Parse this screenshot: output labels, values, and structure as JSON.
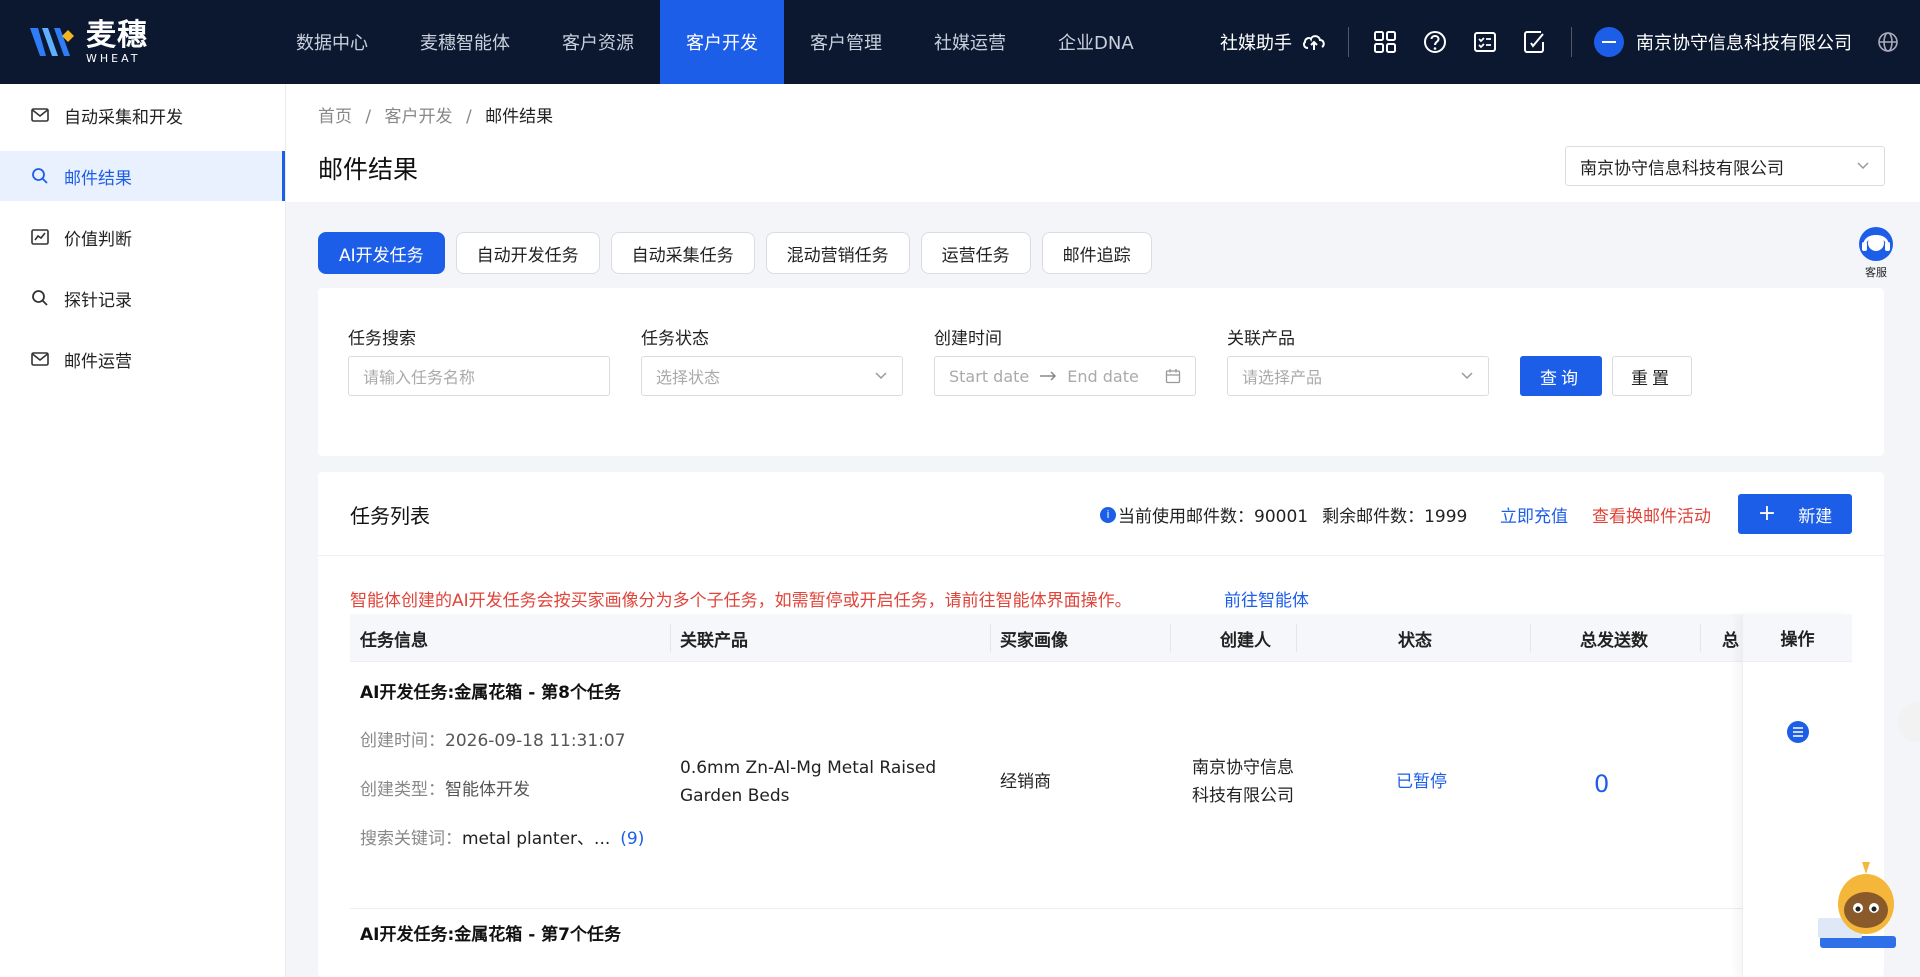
{
  "brand": {
    "name_cn": "麦穗",
    "name_en": "WHEAT"
  },
  "nav": {
    "items": [
      "数据中心",
      "麦穗智能体",
      "客户资源",
      "客户开发",
      "客户管理",
      "社媒运营",
      "企业DNA"
    ],
    "active": "客户开发"
  },
  "topright": {
    "assistant": "社媒助手",
    "company": "南京协守信息科技有限公司"
  },
  "sidebar": {
    "items": [
      {
        "label": "自动采集和开发",
        "icon": "mail-icon"
      },
      {
        "label": "邮件结果",
        "icon": "search-icon"
      },
      {
        "label": "价值判断",
        "icon": "chart-icon"
      },
      {
        "label": "探针记录",
        "icon": "search-icon"
      },
      {
        "label": "邮件运营",
        "icon": "mail-icon"
      }
    ],
    "active": "邮件结果"
  },
  "breadcrumb": {
    "home": "首页",
    "sep": "/",
    "parent": "客户开发",
    "current": "邮件结果"
  },
  "page": {
    "title": "邮件结果",
    "company_select": "南京协守信息科技有限公司"
  },
  "tabs": [
    "AI开发任务",
    "自动开发任务",
    "自动采集任务",
    "混动营销任务",
    "运营任务",
    "邮件追踪"
  ],
  "service": {
    "label": "客服"
  },
  "filters": {
    "task_search": {
      "label": "任务搜索",
      "placeholder": "请输入任务名称"
    },
    "task_status": {
      "label": "任务状态",
      "placeholder": "选择状态"
    },
    "created_time": {
      "label": "创建时间",
      "start": "Start date",
      "end": "End date"
    },
    "product": {
      "label": "关联产品",
      "placeholder": "请选择产品"
    },
    "query": "查询",
    "reset": "重置"
  },
  "list": {
    "title": "任务列表",
    "quota_used": "当前使用邮件数：90001",
    "quota_left": "剩余邮件数：1999",
    "recharge": "立即充值",
    "view_activity": "查看换邮件活动",
    "new": "新建",
    "notice": "智能体创建的AI开发任务会按买家画像分为多个子任务，如需暂停或开启任务，请前往智能体界面操作。",
    "notice_link": "前往智能体"
  },
  "table": {
    "headers": {
      "info": "任务信息",
      "product": "关联产品",
      "persona": "买家画像",
      "creator": "创建人",
      "status": "状态",
      "total_sent": "总发送数",
      "more": "总",
      "ops": "操作"
    },
    "rows": [
      {
        "title": "AI开发任务:金属花箱 - 第8个任务",
        "created_label": "创建时间：",
        "created": "2026-09-18 11:31:07",
        "type_label": "创建类型：",
        "type": "智能体开发",
        "kw_label": "搜索关键词：",
        "keywords": "metal planter、...",
        "kw_count": "(9)",
        "product_line1": "0.6mm Zn-Al-Mg Metal Raised",
        "product_line2": "Garden Beds",
        "persona": "经销商",
        "creator_line1": "南京协守信息",
        "creator_line2": "科技有限公司",
        "status": "已暂停",
        "total_sent": "0"
      },
      {
        "title": "AI开发任务:金属花箱 - 第7个任务"
      }
    ]
  },
  "colors": {
    "primary": "#1d5ee8",
    "nav_bg": "#0b1830",
    "danger": "#e0443a"
  }
}
